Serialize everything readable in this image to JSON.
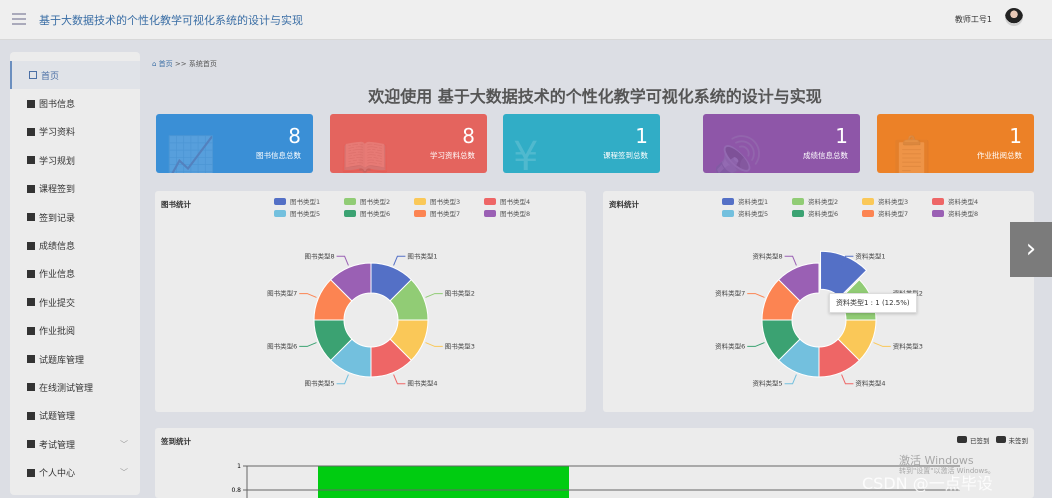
{
  "header": {
    "title": "基于大数据技术的个性化教学可视化系统的设计与实现",
    "user": "教师工号1"
  },
  "sidebar": {
    "items": [
      {
        "label": "首页"
      },
      {
        "label": "图书信息"
      },
      {
        "label": "学习资料"
      },
      {
        "label": "学习规划"
      },
      {
        "label": "课程签到"
      },
      {
        "label": "签到记录"
      },
      {
        "label": "成绩信息"
      },
      {
        "label": "作业信息"
      },
      {
        "label": "作业提交"
      },
      {
        "label": "作业批阅"
      },
      {
        "label": "试题库管理"
      },
      {
        "label": "在线测试管理"
      },
      {
        "label": "试题管理"
      },
      {
        "label": "考试管理"
      },
      {
        "label": "个人中心"
      }
    ]
  },
  "breadcrumb": {
    "home": "首页",
    "sep": ">>",
    "current": "系统首页"
  },
  "page_title": "欢迎使用 基于大数据技术的个性化教学可视化系统的设计与实现",
  "cards": [
    {
      "value": "8",
      "label": "图书信息总数",
      "color": "#3a8fd6"
    },
    {
      "value": "8",
      "label": "学习资料总数",
      "color": "#e4645e"
    },
    {
      "value": "1",
      "label": "课程签到总数",
      "color": "#31adc6"
    },
    {
      "value": "1",
      "label": "成绩信息总数",
      "color": "#8e56a8"
    },
    {
      "value": "1",
      "label": "作业批阅总数",
      "color": "#ec8127"
    }
  ],
  "next_label": "›",
  "tooltip": "资料类型1 : 1 (12.5%)",
  "chart_data": [
    {
      "type": "pie",
      "title": "图书统计",
      "categories": [
        "图书类型1",
        "图书类型2",
        "图书类型3",
        "图书类型4",
        "图书类型5",
        "图书类型6",
        "图书类型7",
        "图书类型8"
      ],
      "values": [
        1,
        1,
        1,
        1,
        1,
        1,
        1,
        1
      ],
      "colors": [
        "#5470c6",
        "#91cc75",
        "#fac858",
        "#ee6666",
        "#73c0de",
        "#3ba272",
        "#fc8452",
        "#9a60b4"
      ]
    },
    {
      "type": "pie",
      "title": "资料统计",
      "categories": [
        "资料类型1",
        "资料类型2",
        "资料类型3",
        "资料类型4",
        "资料类型5",
        "资料类型6",
        "资料类型7",
        "资料类型8"
      ],
      "values": [
        1,
        1,
        1,
        1,
        1,
        1,
        1,
        1
      ],
      "colors": [
        "#5470c6",
        "#91cc75",
        "#fac858",
        "#ee6666",
        "#73c0de",
        "#3ba272",
        "#fc8452",
        "#9a60b4"
      ],
      "highlighted": 0
    },
    {
      "type": "bar",
      "title": "签到统计",
      "legend": [
        "已签到",
        "未签到"
      ],
      "yticks": [
        "1",
        "0.8"
      ],
      "ylim": [
        0,
        1
      ],
      "values": [
        1
      ],
      "bar_color": "#00cc11"
    }
  ],
  "watermark": {
    "activate": "激活 Windows",
    "activate_sub": "转到\"设置\"以激活 Windows。",
    "csdn": "CSDN @一点毕设"
  }
}
